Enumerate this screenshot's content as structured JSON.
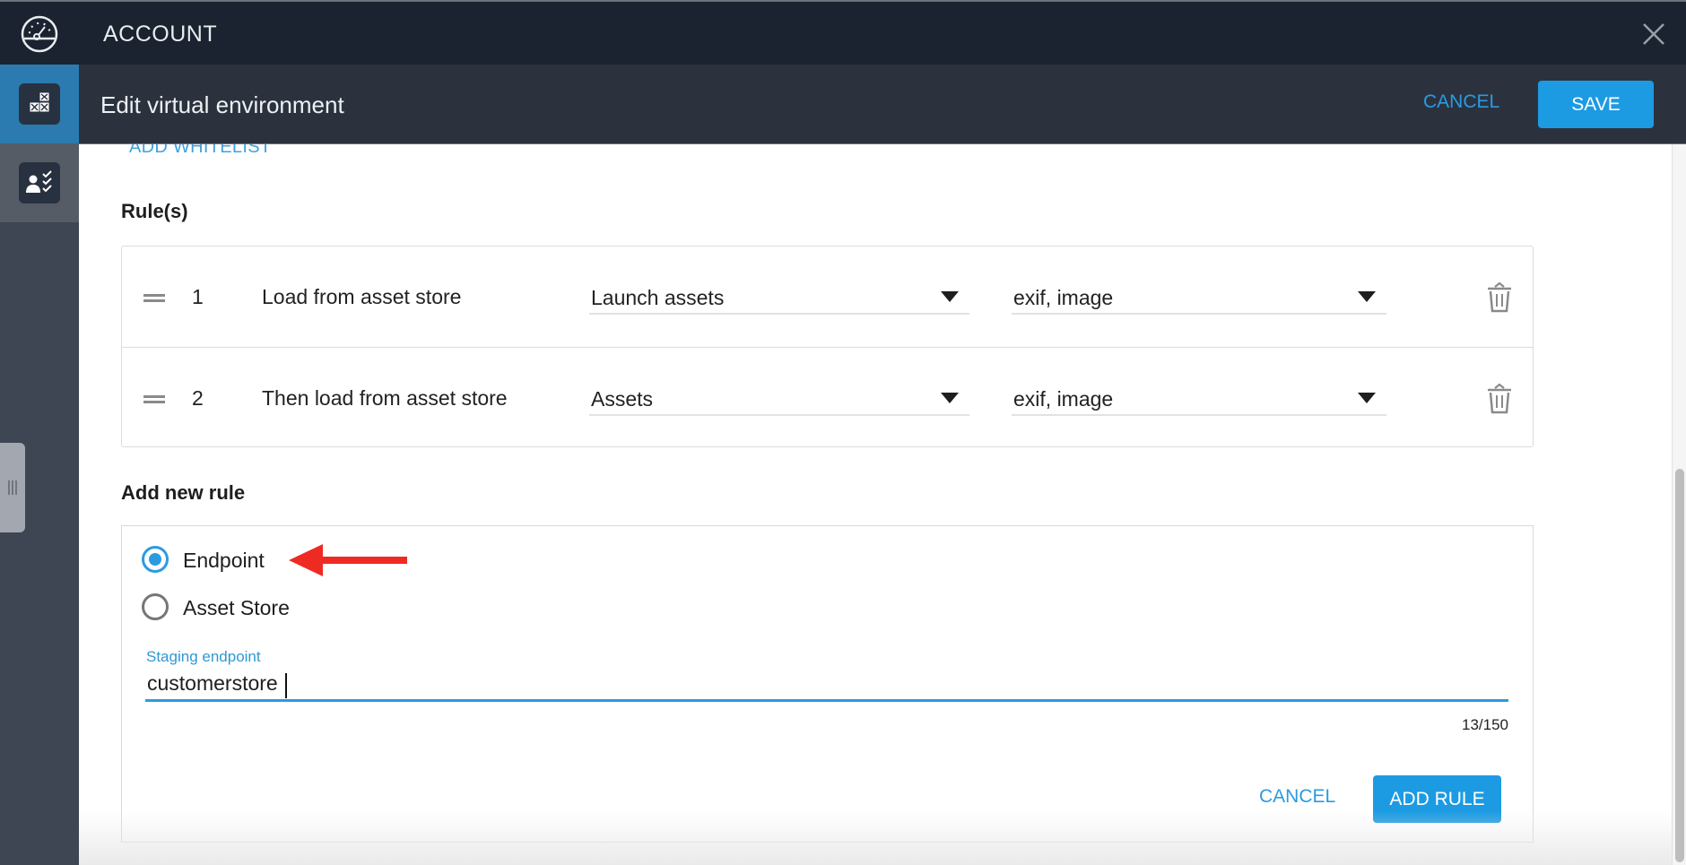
{
  "topbar": {
    "title": "ACCOUNT",
    "logo_icon": "speedometer-icon",
    "close_icon": "close-icon"
  },
  "rail": {
    "items": [
      {
        "icon": "crates-icon",
        "active": true
      },
      {
        "icon": "user-checklist-icon",
        "active": false
      }
    ]
  },
  "subheader": {
    "title": "Edit virtual environment",
    "cancel_label": "CANCEL",
    "save_label": "SAVE"
  },
  "main": {
    "add_whitelist_label": "ADD WHITELIST",
    "rules_title": "Rule(s)",
    "rules": [
      {
        "number": "1",
        "label": "Load from asset store",
        "source": "Launch assets",
        "types": "exif, image"
      },
      {
        "number": "2",
        "label": "Then load from asset store",
        "source": "Assets",
        "types": "exif, image"
      }
    ],
    "add_rule_title": "Add new rule",
    "add_rule": {
      "options": [
        {
          "label": "Endpoint",
          "selected": true
        },
        {
          "label": "Asset Store",
          "selected": false
        }
      ],
      "field_label": "Staging endpoint",
      "field_value": "customerstore",
      "char_count": "13/150",
      "cancel_label": "CANCEL",
      "add_label": "ADD RULE"
    }
  },
  "colors": {
    "accent": "#1d9be2",
    "topbar_bg": "#1b2230",
    "subheader_bg": "#2b323e",
    "rail_active": "#2b7bb0",
    "annotation_arrow": "#ee2b22"
  },
  "scroll": {
    "position_fraction": 0.45,
    "visible_fraction": 0.55
  }
}
